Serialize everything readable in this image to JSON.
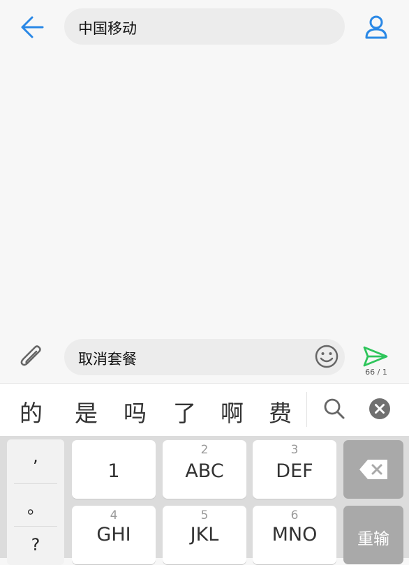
{
  "header": {
    "recipient": "中国移动"
  },
  "compose": {
    "text": "取消套餐",
    "counter": "66 / 1"
  },
  "candidates": [
    "的",
    "是",
    "吗",
    "了",
    "啊",
    "费"
  ],
  "keyboard": {
    "punct": [
      ",",
      "。",
      "?"
    ],
    "keys": [
      {
        "num": "",
        "label": "1"
      },
      {
        "num": "2",
        "label": "ABC"
      },
      {
        "num": "3",
        "label": "DEF"
      },
      {
        "num": "4",
        "label": "GHI"
      },
      {
        "num": "5",
        "label": "JKL"
      },
      {
        "num": "6",
        "label": "MNO"
      }
    ],
    "retype": "重输"
  },
  "colors": {
    "accent": "#2a88e6",
    "send": "#2ec55b",
    "func_key": "#a9a9a9"
  },
  "icons": [
    "back-arrow-icon",
    "contact-icon",
    "paperclip-icon",
    "emoji-icon",
    "send-icon",
    "search-icon",
    "close-icon",
    "backspace-icon"
  ]
}
